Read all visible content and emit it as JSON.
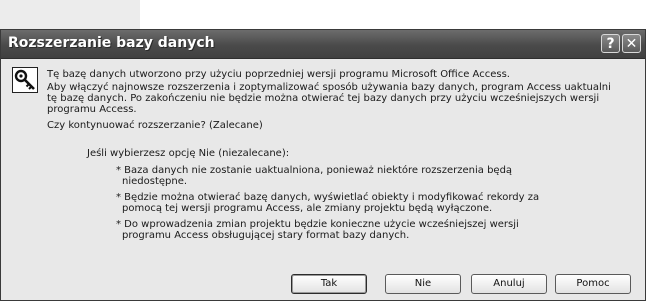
{
  "dialog": {
    "title": "Rozszerzanie bazy danych",
    "help_glyph": "?",
    "close_glyph": "✕",
    "icon": "key-icon",
    "lines": {
      "l1": "Tę bazę danych utworzono przy użyciu poprzedniej wersji programu Microsoft Office Access.",
      "l2": "Aby włączyć najnowsze rozszerzenia i zoptymalizować sposób używania bazy danych, program Access uaktualni",
      "l3": "tę bazę danych. Po zakończeniu nie będzie można otwierać tej bazy danych przy użyciu wcześniejszych wersji",
      "l4": "programu Access.",
      "l5": "Czy kontynuować rozszerzanie? (Zalecane)",
      "l6": "Jeśli wybierzesz opcję Nie (niezalecane):",
      "l7": "* Baza danych nie zostanie uaktualniona, ponieważ niektóre rozszerzenia będą",
      "l8": "niedostępne.",
      "l9": "* Będzie można otwierać bazę danych, wyświetlać obiekty i modyfikować rekordy za",
      "l10": "pomocą tej wersji programu Access, ale zmiany projektu będą wyłączone.",
      "l11": "* Do wprowadzenia zmian projektu będzie konieczne użycie wcześniejszej wersji",
      "l12": "programu Access obsługującej stary format bazy danych."
    },
    "buttons": {
      "yes": "Tak",
      "no": "Nie",
      "cancel": "Anuluj",
      "help": "Pomoc"
    }
  }
}
